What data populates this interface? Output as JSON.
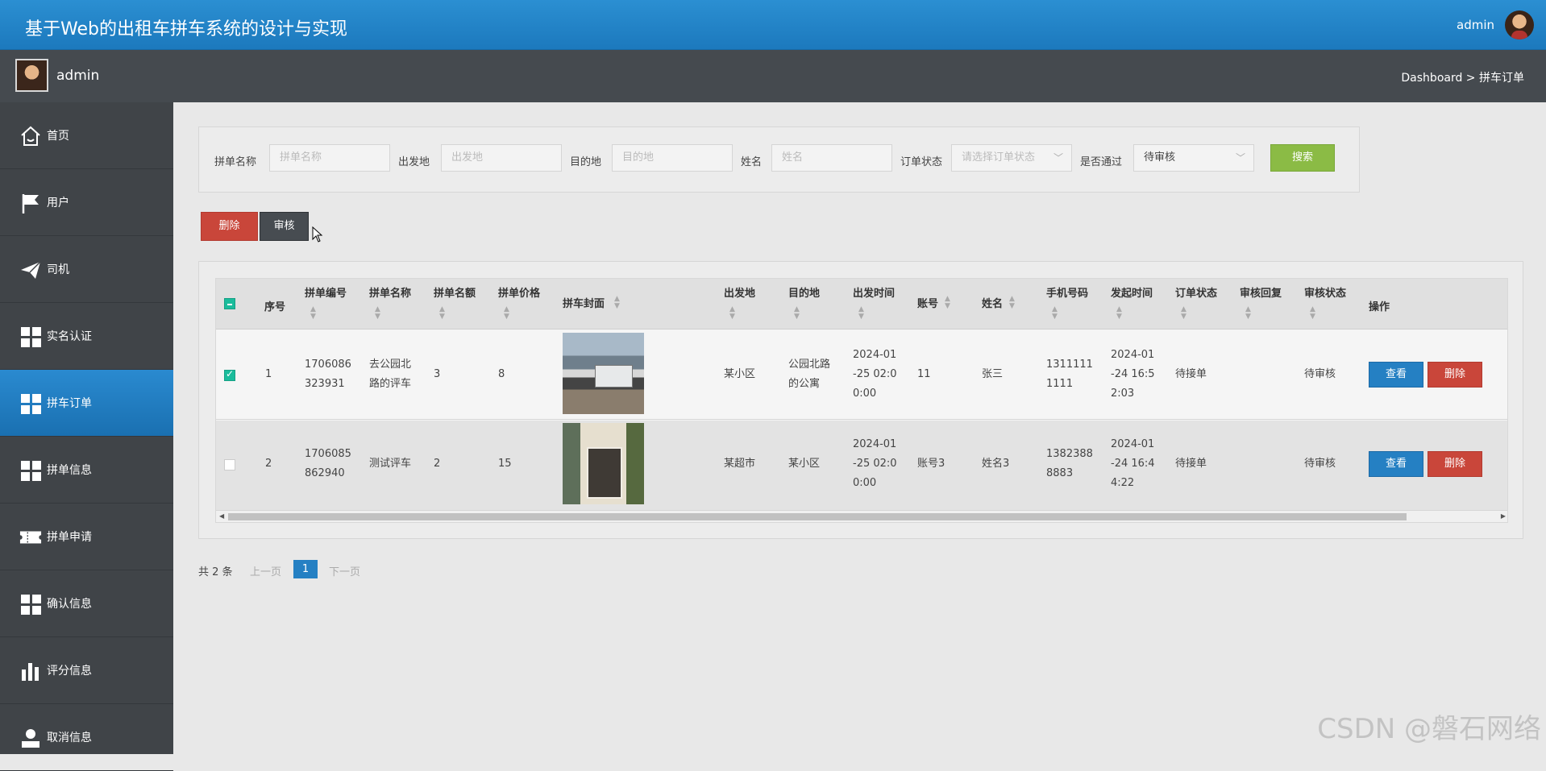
{
  "header": {
    "title": "基于Web的出租车拼车系统的设计与实现",
    "user": "admin"
  },
  "subbar": {
    "user": "admin",
    "breadcrumb": "Dashboard > 拼车订单"
  },
  "sidebar": {
    "items": [
      {
        "label": "首页",
        "icon": "home-icon"
      },
      {
        "label": "用户",
        "icon": "flag-icon"
      },
      {
        "label": "司机",
        "icon": "paper-plane-icon"
      },
      {
        "label": "实名认证",
        "icon": "grid-icon"
      },
      {
        "label": "拼车订单",
        "icon": "grid-icon",
        "active": true
      },
      {
        "label": "拼单信息",
        "icon": "grid-icon"
      },
      {
        "label": "拼单申请",
        "icon": "ticket-icon"
      },
      {
        "label": "确认信息",
        "icon": "grid-icon"
      },
      {
        "label": "评分信息",
        "icon": "bar-chart-icon"
      },
      {
        "label": "取消信息",
        "icon": "user-icon"
      }
    ]
  },
  "search": {
    "f1": {
      "label": "拼单名称",
      "placeholder": "拼单名称"
    },
    "f2": {
      "label": "出发地",
      "placeholder": "出发地"
    },
    "f3": {
      "label": "目的地",
      "placeholder": "目的地"
    },
    "f4": {
      "label": "姓名",
      "placeholder": "姓名"
    },
    "f5": {
      "label": "订单状态",
      "placeholder": "请选择订单状态"
    },
    "f6": {
      "label": "是否通过",
      "value": "待审核"
    },
    "button": "搜索"
  },
  "toolbar": {
    "delete": "删除",
    "review": "审核"
  },
  "table": {
    "headers": [
      "序号",
      "拼单编号",
      "拼单名称",
      "拼单名额",
      "拼单价格",
      "拼车封面",
      "出发地",
      "目的地",
      "出发时间",
      "账号",
      "姓名",
      "手机号码",
      "发起时间",
      "订单状态",
      "审核回复",
      "审核状态",
      "操作"
    ],
    "rows": [
      {
        "idx": "1",
        "code1": "1706086",
        "code2": "323931",
        "name1": "去公园北",
        "name2": "路的评车",
        "seats": "3",
        "price": "8",
        "from": "某小区",
        "to1": "公园北路",
        "to2": "的公寓",
        "depart1": "2024-01",
        "depart2": "-25 02:0",
        "depart3": "0:00",
        "account": "11",
        "person": "张三",
        "phone1": "1311111",
        "phone2": "1111",
        "created1": "2024-01",
        "created2": "-24 16:5",
        "created3": "2:03",
        "status": "待接单",
        "reply": "",
        "review": "待审核",
        "checked": true
      },
      {
        "idx": "2",
        "code1": "1706085",
        "code2": "862940",
        "name1": "测试评车",
        "name2": "",
        "seats": "2",
        "price": "15",
        "from": "某超市",
        "to1": "某小区",
        "to2": "",
        "depart1": "2024-01",
        "depart2": "-25 02:0",
        "depart3": "0:00",
        "account": "账号3",
        "person": "姓名3",
        "phone1": "1382388",
        "phone2": "8883",
        "created1": "2024-01",
        "created2": "-24 16:4",
        "created3": "4:22",
        "status": "待接单",
        "reply": "",
        "review": "待审核",
        "checked": false
      }
    ],
    "view_label": "查看",
    "delete_label": "删除"
  },
  "pager": {
    "total": "共 2 条",
    "prev": "上一页",
    "current": "1",
    "next": "下一页"
  },
  "watermark": "CSDN @磐石网络",
  "colors": {
    "header_blue": "#1f80c4",
    "sidebar": "#404448",
    "active": "#2583c7",
    "danger": "#c9463a",
    "search": "#8bbb45"
  }
}
